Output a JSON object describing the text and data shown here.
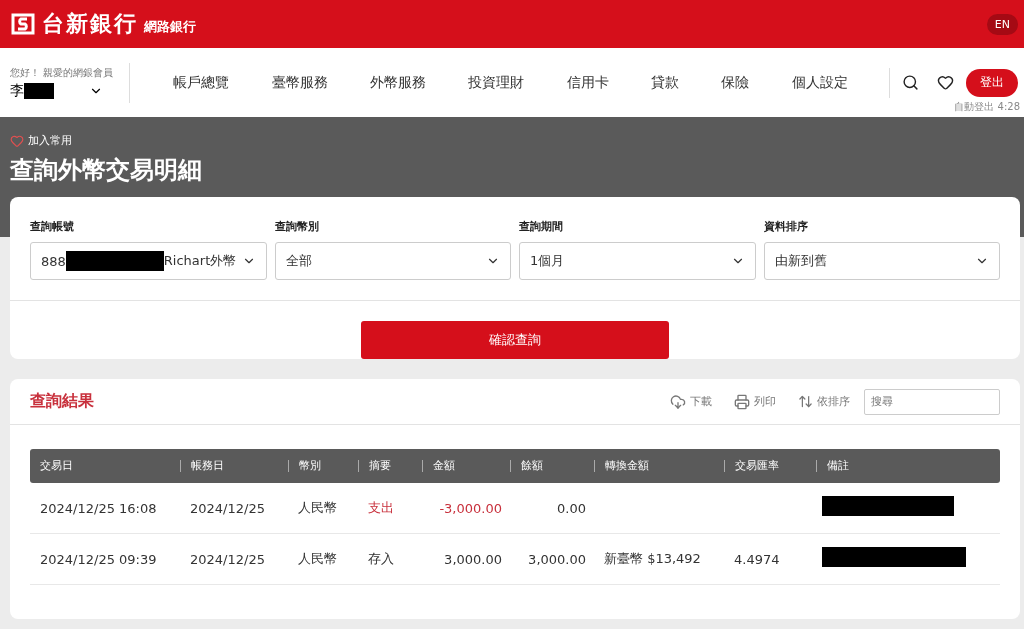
{
  "header": {
    "bank_name": "台新銀行",
    "service_name": "網路銀行",
    "language_button": "EN"
  },
  "user": {
    "greeting": "您好！ 親愛的網銀會員",
    "name": "李",
    "name_redacted": true
  },
  "nav": {
    "items": [
      {
        "label": "帳戶總覽"
      },
      {
        "label": "臺幣服務"
      },
      {
        "label": "外幣服務"
      },
      {
        "label": "投資理財"
      },
      {
        "label": "信用卡"
      },
      {
        "label": "貸款"
      },
      {
        "label": "保險"
      },
      {
        "label": "個人設定"
      }
    ],
    "logout_button": "登出",
    "auto_logout_label": "自動登出",
    "auto_logout_time": "4:28"
  },
  "page": {
    "favorite_label": "加入常用",
    "title": "查詢外幣交易明細"
  },
  "query_form": {
    "fields": [
      {
        "label": "查詢帳號",
        "value_start": "888",
        "redacted": true,
        "value_end": "Richart外幣"
      },
      {
        "label": "查詢幣別",
        "value_start": "全部"
      },
      {
        "label": "查詢期間",
        "value_start": "1個月"
      },
      {
        "label": "資料排序",
        "value_start": "由新到舊"
      }
    ],
    "submit_button": "確認查詢"
  },
  "results": {
    "title": "查詢結果",
    "actions": [
      {
        "kind": "download",
        "label": "下載"
      },
      {
        "kind": "print",
        "label": "列印"
      },
      {
        "kind": "sort",
        "label": "依排序"
      }
    ],
    "search": {
      "placeholder": "搜尋"
    },
    "table": {
      "columns": [
        "交易日",
        "帳務日",
        "幣別",
        "摘要",
        "金額",
        "餘額",
        "轉換金額",
        "交易匯率",
        "備註"
      ],
      "rows": [
        {
          "kind": "debit",
          "trade_date": "2024/12/25 16:08",
          "booking_date": "2024/12/25",
          "currency": "人民幣",
          "summary": "支出",
          "amount": "-3,000.00",
          "balance": "0.00",
          "note_redacted": true
        },
        {
          "kind": "credit",
          "trade_date": "2024/12/25 09:39",
          "booking_date": "2024/12/25",
          "currency": "人民幣",
          "summary": "存入",
          "amount": "3,000.00",
          "balance": "3,000.00",
          "converted": "新臺幣 $13,492",
          "rate": "4.4974",
          "note_redacted": true
        }
      ]
    }
  }
}
